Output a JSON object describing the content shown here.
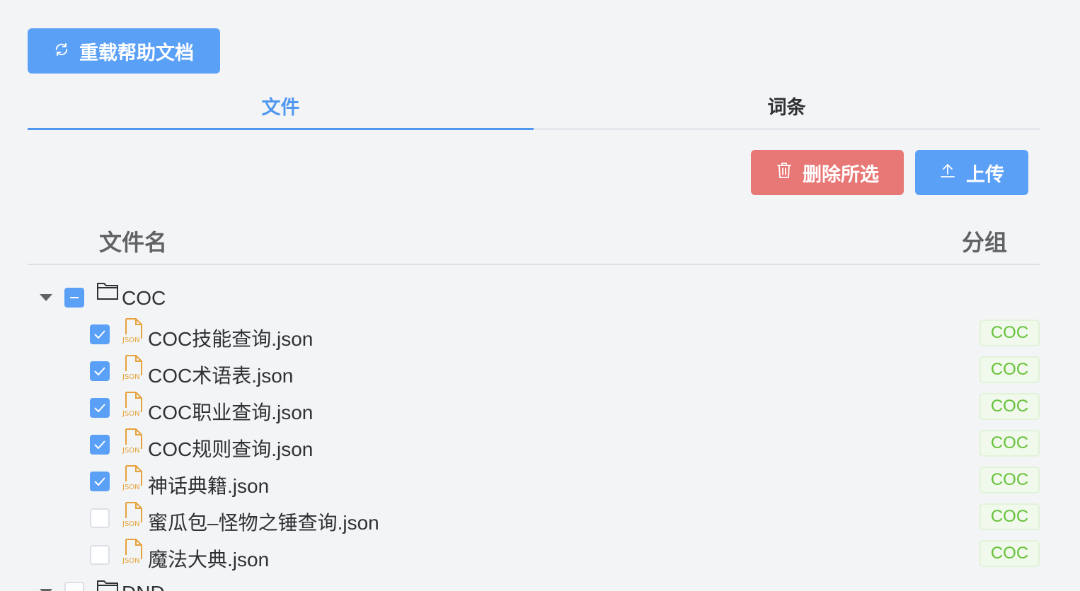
{
  "toolbar": {
    "reload_label": "重载帮助文档",
    "delete_label": "删除所选",
    "upload_label": "上传"
  },
  "tabs": [
    {
      "label": "文件",
      "active": true
    },
    {
      "label": "词条",
      "active": false
    }
  ],
  "table": {
    "col_name": "文件名",
    "col_group": "分组"
  },
  "folders": [
    {
      "name": "COC",
      "expanded": true,
      "check_state": "indeterminate",
      "files": [
        {
          "name": "COC技能查询.json",
          "group": "COC",
          "checked": true
        },
        {
          "name": "COC术语表.json",
          "group": "COC",
          "checked": true
        },
        {
          "name": "COC职业查询.json",
          "group": "COC",
          "checked": true
        },
        {
          "name": "COC规则查询.json",
          "group": "COC",
          "checked": true
        },
        {
          "name": "神话典籍.json",
          "group": "COC",
          "checked": true
        },
        {
          "name": "蜜瓜包–怪物之锤查询.json",
          "group": "COC",
          "checked": false
        },
        {
          "name": "魔法大典.json",
          "group": "COC",
          "checked": false
        }
      ]
    },
    {
      "name": "DND",
      "expanded": true,
      "check_state": "unchecked",
      "files": []
    }
  ],
  "icons": {
    "reload": "refresh-icon",
    "delete": "trash-icon",
    "upload": "upload-icon",
    "folder": "folder-icon",
    "file": "json-file-icon",
    "file_badge": "JSON"
  },
  "colors": {
    "primary": "#5ba0f7",
    "danger": "#e87876",
    "tag_text": "#67c23a",
    "file_icon": "#e6a23c"
  }
}
